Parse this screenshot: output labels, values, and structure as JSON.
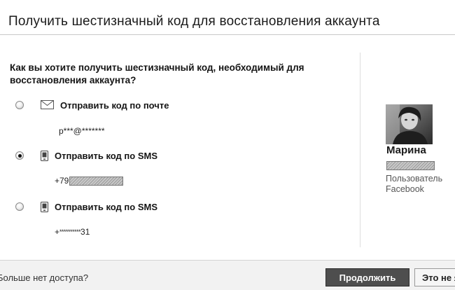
{
  "dialog": {
    "title": "Получить шестизначный код для восстановления аккаунта",
    "question": "Как вы хотите получить шестизначный код, необходимый для восстановления аккаунта?"
  },
  "options": [
    {
      "label": "Отправить код по почте",
      "value": "p***@*******",
      "icon": "mail-icon",
      "selected": false
    },
    {
      "label": "Отправить код по SMS",
      "value_prefix": "+79",
      "icon": "phone-icon",
      "selected": true
    },
    {
      "label": "Отправить код по SMS",
      "value_prefix": "+",
      "value_mask": "**********",
      "value_suffix": "31",
      "icon": "phone-icon",
      "selected": false
    }
  ],
  "profile": {
    "name": "Марина",
    "subtitle_line1": "Пользователь",
    "subtitle_line2": "Facebook"
  },
  "footer": {
    "no_access_link": "Больше нет доступа?",
    "continue_button": "Продолжить",
    "other_button": "Это не я"
  }
}
